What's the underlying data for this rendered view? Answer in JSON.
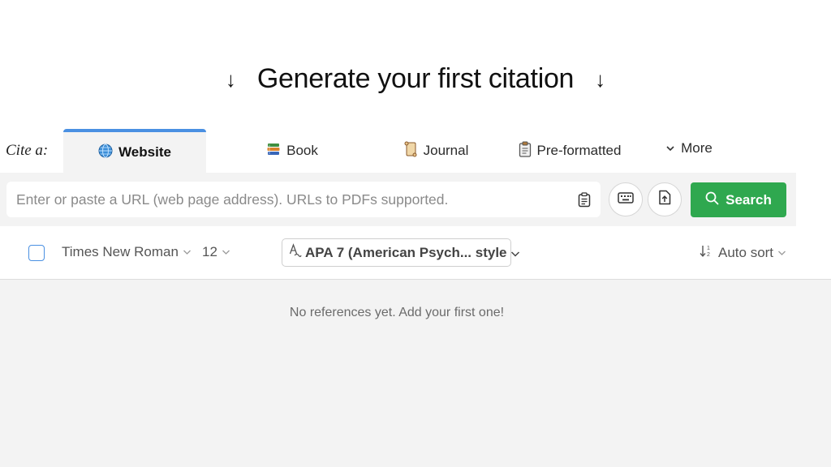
{
  "heading": {
    "title": "Generate your first citation",
    "left_icon": "arrow-down-icon",
    "right_icon": "arrow-down-icon"
  },
  "tabs": {
    "cite_label": "Cite a:",
    "items": [
      {
        "label": "Website",
        "icon": "globe-icon",
        "active": true
      },
      {
        "label": "Book",
        "icon": "books-icon",
        "active": false
      },
      {
        "label": "Journal",
        "icon": "scroll-icon",
        "active": false
      },
      {
        "label": "Pre-formatted",
        "icon": "clipboard-icon",
        "active": false
      },
      {
        "label": "More",
        "icon": "chevron-down-icon",
        "active": false
      }
    ]
  },
  "search": {
    "placeholder": "Enter or paste a URL (web page address). URLs to PDFs supported.",
    "value": "",
    "button_label": "Search"
  },
  "options": {
    "font": "Times New Roman",
    "size": "12",
    "style": "APA 7 (American Psych... style",
    "sort": "Auto sort"
  },
  "references": {
    "empty_message": "No references yet. Add your first one!"
  },
  "colors": {
    "accent_blue": "#4a90e2",
    "search_green": "#2fa84f",
    "panel_gray": "#f3f3f3"
  }
}
